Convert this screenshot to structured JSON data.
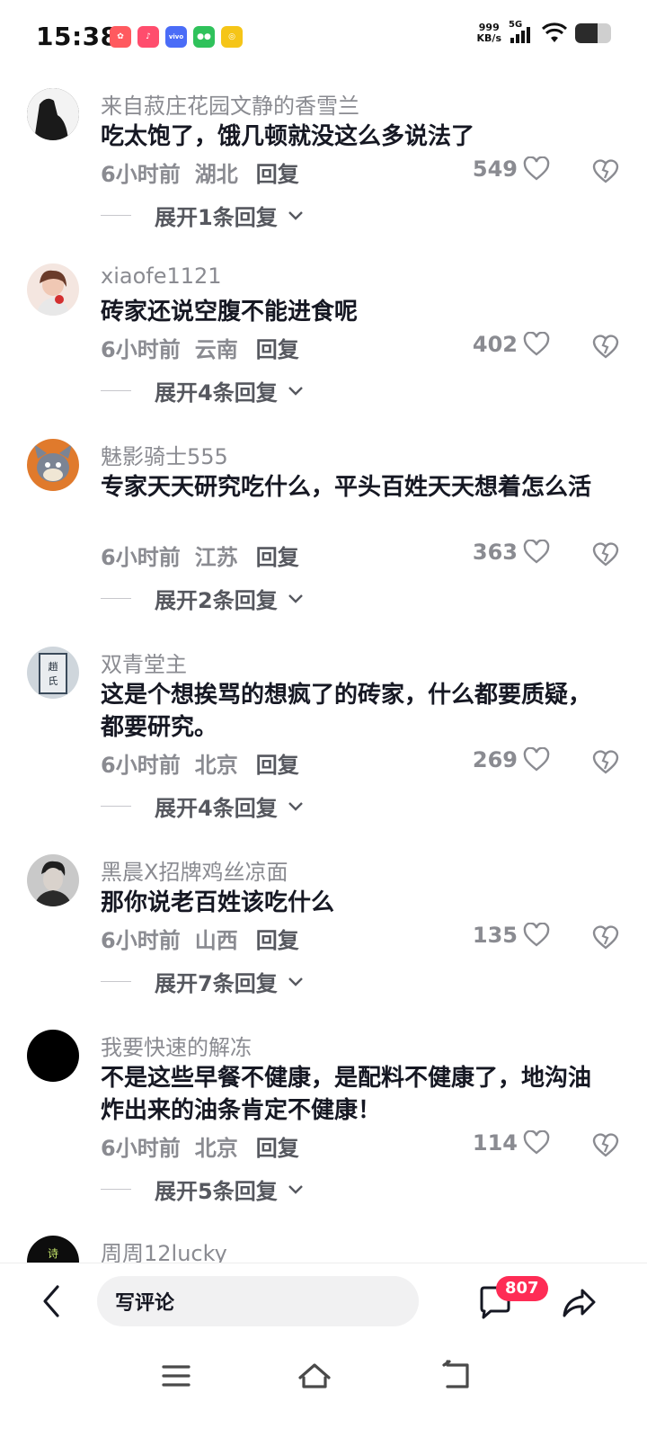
{
  "status_bar": {
    "time": "15:38",
    "net_speed_value": "999",
    "net_speed_unit": "KB/s",
    "network": "5G",
    "app_icons": [
      "game-icon",
      "douyin-icon",
      "vivo-icon",
      "wechat-icon",
      "coin-icon"
    ]
  },
  "comments": [
    {
      "user": "来自菽庄花园文静的香雪兰",
      "text": "吃太饱了，饿几顿就没这么多说法了",
      "time": "6小时前",
      "location": "湖北",
      "reply": "回复",
      "likes": "549",
      "expand": "展开1条回复"
    },
    {
      "user": "xiaofe1121",
      "text": "砖家还说空腹不能进食呢",
      "time": "6小时前",
      "location": "云南",
      "reply": "回复",
      "likes": "402",
      "expand": "展开4条回复"
    },
    {
      "user": "魅影骑士555",
      "text": "专家天天研究吃什么，平头百姓天天想着怎么活",
      "time": "6小时前",
      "location": "江苏",
      "reply": "回复",
      "likes": "363",
      "expand": "展开2条回复"
    },
    {
      "user": "双青堂主",
      "text": "这是个想挨骂的想疯了的砖家，什么都要质疑，都要研究。",
      "time": "6小时前",
      "location": "北京",
      "reply": "回复",
      "likes": "269",
      "expand": "展开4条回复"
    },
    {
      "user": "黑晨X招牌鸡丝凉面",
      "text": "那你说老百姓该吃什么",
      "time": "6小时前",
      "location": "山西",
      "reply": "回复",
      "likes": "135",
      "expand": "展开7条回复"
    },
    {
      "user": "我要快速的解冻",
      "text": "不是这些早餐不健康，是配料不健康了，地沟油炸出来的油条肯定不健康！",
      "time": "6小时前",
      "location": "北京",
      "reply": "回复",
      "likes": "114",
      "expand": "展开5条回复"
    },
    {
      "user": "周周12lucky",
      "text": "",
      "time": "",
      "location": "",
      "reply": "",
      "likes": "",
      "expand": ""
    }
  ],
  "input_bar": {
    "placeholder": "写评论",
    "comment_count": "807"
  },
  "colors": {
    "badge": "#fe2c55",
    "muted": "#8a8b91",
    "text": "#161823"
  }
}
